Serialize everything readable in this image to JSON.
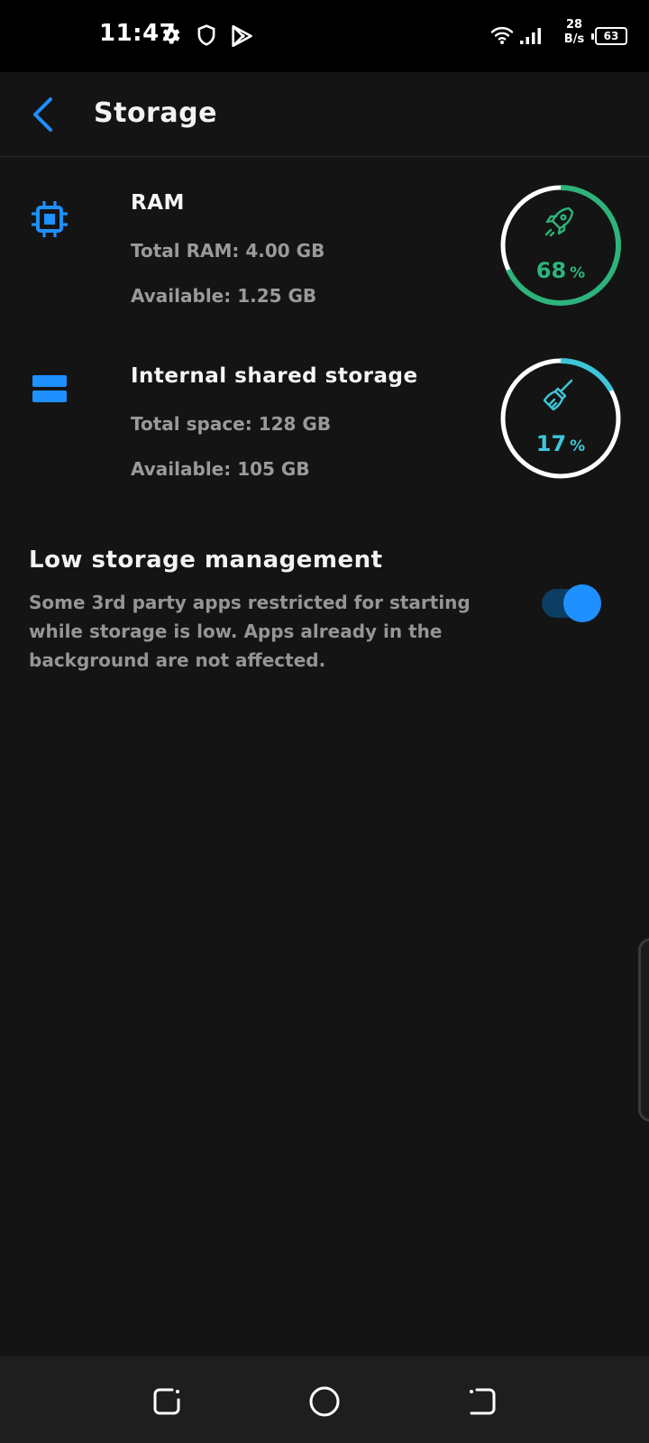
{
  "status_bar": {
    "time": "11:47",
    "net_speed_value": "28",
    "net_speed_unit": "B/s",
    "battery": "63",
    "icons": [
      "gear-icon",
      "shield-icon",
      "play-store-icon",
      "wifi-icon",
      "signal-icon",
      "battery-icon"
    ]
  },
  "header": {
    "title": "Storage",
    "back_icon": "chevron-left-icon"
  },
  "ram": {
    "title": "RAM",
    "total": "Total RAM: 4.00 GB",
    "available": "Available: 1.25 GB",
    "percent": "68",
    "percent_unit": "%",
    "fraction": 0.68,
    "color": "#2db37b",
    "icon": "cpu-chip-icon",
    "gauge_icon": "rocket-icon"
  },
  "storage": {
    "title": "Internal shared storage",
    "total": "Total space: 128 GB",
    "available": "Available: 105 GB",
    "percent": "17",
    "percent_unit": "%",
    "fraction": 0.17,
    "color": "#3ec6d8",
    "icon": "storage-drive-icon",
    "gauge_icon": "broom-icon"
  },
  "low_storage": {
    "title": "Low storage management",
    "description": "Some 3rd party apps restricted for starting while storage is low. Apps already in the background are not affected.",
    "enabled": true
  },
  "colors": {
    "accent": "#1e90ff",
    "background": "#141414",
    "ring_track": "#ffffff"
  }
}
